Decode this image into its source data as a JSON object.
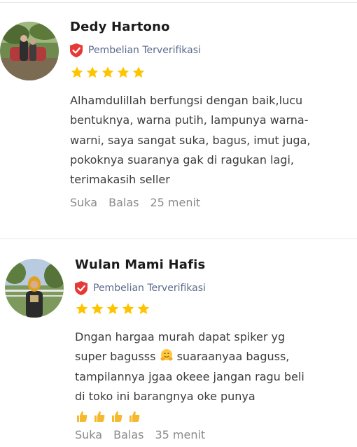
{
  "reviews": [
    {
      "name": "Dedy Hartono",
      "verified_label": "Pembelian Terverifikasi",
      "rating": 5,
      "text": "Alhamdulillah berfungsi dengan baik,lucu bentuknya, warna putih, lampunya warna-warni, saya sangat suka, bagus, imut juga, pokoknya suaranya gak di ragukan lagi, terimakasih seller",
      "like_label": "Suka",
      "reply_label": "Balas",
      "time": "25 menit"
    },
    {
      "name": "Wulan Mami Hafis",
      "verified_label": "Pembelian Terverifikasi",
      "rating": 5,
      "text_part1": "Dngan hargaa murah dapat spiker yg super bagusss",
      "text_part2": "suaraanyaa baguss, tampilannya jgaa okeee jangan ragu beli di toko ini barangnya oke punya",
      "like_label": "Suka",
      "reply_label": "Balas",
      "time": "35 menit"
    }
  ],
  "colors": {
    "star": "#FFC400",
    "shield": "#E53935",
    "verified_text": "#5a6a8a"
  }
}
